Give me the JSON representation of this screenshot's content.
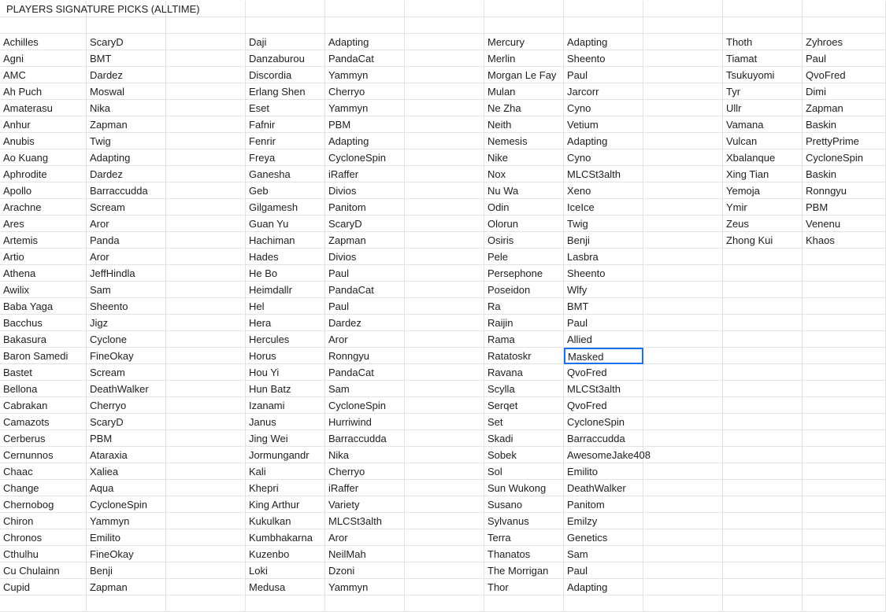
{
  "title": "PLAYERS SIGNATURE PICKS (ALLTIME)",
  "selected": {
    "block": 2,
    "row": 19
  },
  "blocks": [
    {
      "rows": [
        [
          "Achilles",
          "ScaryD"
        ],
        [
          "Agni",
          "BMT"
        ],
        [
          "AMC",
          "Dardez"
        ],
        [
          "Ah Puch",
          "Moswal"
        ],
        [
          "Amaterasu",
          "Nika"
        ],
        [
          "Anhur",
          "Zapman"
        ],
        [
          "Anubis",
          "Twig"
        ],
        [
          "Ao Kuang",
          "Adapting"
        ],
        [
          "Aphrodite",
          "Dardez"
        ],
        [
          "Apollo",
          "Barraccudda"
        ],
        [
          "Arachne",
          "Scream"
        ],
        [
          "Ares",
          "Aror"
        ],
        [
          "Artemis",
          "Panda"
        ],
        [
          "Artio",
          "Aror"
        ],
        [
          "Athena",
          "JeffHindla"
        ],
        [
          "Awilix",
          "Sam"
        ],
        [
          "Baba Yaga",
          "Sheento"
        ],
        [
          "Bacchus",
          "Jigz"
        ],
        [
          "Bakasura",
          "Cyclone"
        ],
        [
          "Baron Samedi",
          "FineOkay"
        ],
        [
          "Bastet",
          "Scream"
        ],
        [
          "Bellona",
          "DeathWalker"
        ],
        [
          "Cabrakan",
          "Cherryo"
        ],
        [
          "Camazots",
          "ScaryD"
        ],
        [
          "Cerberus",
          "PBM"
        ],
        [
          "Cernunnos",
          "Ataraxia"
        ],
        [
          "Chaac",
          "Xaliea"
        ],
        [
          "Change",
          "Aqua"
        ],
        [
          "Chernobog",
          "CycloneSpin"
        ],
        [
          "Chiron",
          "Yammyn"
        ],
        [
          "Chronos",
          "Emilito"
        ],
        [
          "Cthulhu",
          "FineOkay"
        ],
        [
          "Cu Chulainn",
          "Benji"
        ],
        [
          "Cupid",
          "Zapman"
        ]
      ]
    },
    {
      "rows": [
        [
          "Daji",
          "Adapting"
        ],
        [
          "Danzaburou",
          "PandaCat"
        ],
        [
          "Discordia",
          "Yammyn"
        ],
        [
          "Erlang Shen",
          "Cherryo"
        ],
        [
          "Eset",
          "Yammyn"
        ],
        [
          "Fafnir",
          "PBM"
        ],
        [
          "Fenrir",
          "Adapting"
        ],
        [
          "Freya",
          "CycloneSpin"
        ],
        [
          "Ganesha",
          "iRaffer"
        ],
        [
          "Geb",
          "Divios"
        ],
        [
          "Gilgamesh",
          "Panitom"
        ],
        [
          "Guan Yu",
          "ScaryD"
        ],
        [
          "Hachiman",
          "Zapman"
        ],
        [
          "Hades",
          "Divios"
        ],
        [
          "He Bo",
          "Paul"
        ],
        [
          "Heimdallr",
          "PandaCat"
        ],
        [
          "Hel",
          "Paul"
        ],
        [
          "Hera",
          "Dardez"
        ],
        [
          "Hercules",
          "Aror"
        ],
        [
          "Horus",
          "Ronngyu"
        ],
        [
          "Hou Yi",
          "PandaCat"
        ],
        [
          "Hun Batz",
          "Sam"
        ],
        [
          "Izanami",
          "CycloneSpin"
        ],
        [
          "Janus",
          "Hurriwind"
        ],
        [
          "Jing Wei",
          "Barraccudda"
        ],
        [
          "Jormungandr",
          "Nika"
        ],
        [
          "Kali",
          "Cherryo"
        ],
        [
          "Khepri",
          "iRaffer"
        ],
        [
          "King Arthur",
          "Variety"
        ],
        [
          "Kukulkan",
          "MLCSt3alth"
        ],
        [
          "Kumbhakarna",
          "Aror"
        ],
        [
          "Kuzenbo",
          "NeilMah"
        ],
        [
          "Loki",
          "Dzoni"
        ],
        [
          "Medusa",
          "Yammyn"
        ]
      ]
    },
    {
      "rows": [
        [
          "Mercury",
          "Adapting"
        ],
        [
          "Merlin",
          "Sheento"
        ],
        [
          "Morgan Le Fay",
          "Paul"
        ],
        [
          "Mulan",
          "Jarcorr"
        ],
        [
          "Ne Zha",
          "Cyno"
        ],
        [
          "Neith",
          "Vetium"
        ],
        [
          "Nemesis",
          "Adapting"
        ],
        [
          "Nike",
          "Cyno"
        ],
        [
          "Nox",
          "MLCSt3alth"
        ],
        [
          "Nu Wa",
          "Xeno"
        ],
        [
          "Odin",
          "IceIce"
        ],
        [
          "Olorun",
          "Twig"
        ],
        [
          "Osiris",
          "Benji"
        ],
        [
          "Pele",
          "Lasbra"
        ],
        [
          "Persephone",
          "Sheento"
        ],
        [
          "Poseidon",
          "Wlfy"
        ],
        [
          "Ra",
          "BMT"
        ],
        [
          "Raijin",
          "Paul"
        ],
        [
          "Rama",
          "Allied"
        ],
        [
          "Ratatoskr",
          "Masked"
        ],
        [
          "Ravana",
          "QvoFred"
        ],
        [
          "Scylla",
          "MLCSt3alth"
        ],
        [
          "Serqet",
          "QvoFred"
        ],
        [
          "Set",
          "CycloneSpin"
        ],
        [
          "Skadi",
          "Barraccudda"
        ],
        [
          "Sobek",
          "AwesomeJake408"
        ],
        [
          "Sol",
          "Emilito"
        ],
        [
          "Sun Wukong",
          "DeathWalker"
        ],
        [
          "Susano",
          "Panitom"
        ],
        [
          "Sylvanus",
          "Emilzy"
        ],
        [
          "Terra",
          "Genetics"
        ],
        [
          "Thanatos",
          "Sam"
        ],
        [
          "The Morrigan",
          "Paul"
        ],
        [
          "Thor",
          "Adapting"
        ]
      ]
    },
    {
      "rows": [
        [
          "Thoth",
          "Zyhroes"
        ],
        [
          "Tiamat",
          "Paul"
        ],
        [
          "Tsukuyomi",
          "QvoFred"
        ],
        [
          "Tyr",
          "Dimi"
        ],
        [
          "Ullr",
          "Zapman"
        ],
        [
          "Vamana",
          "Baskin"
        ],
        [
          "Vulcan",
          "PrettyPrime"
        ],
        [
          "Xbalanque",
          "CycloneSpin"
        ],
        [
          "Xing Tian",
          "Baskin"
        ],
        [
          "Yemoja",
          "Ronngyu"
        ],
        [
          "Ymir",
          "PBM"
        ],
        [
          "Zeus",
          "Venenu"
        ],
        [
          "Zhong Kui",
          "Khaos"
        ]
      ]
    }
  ]
}
